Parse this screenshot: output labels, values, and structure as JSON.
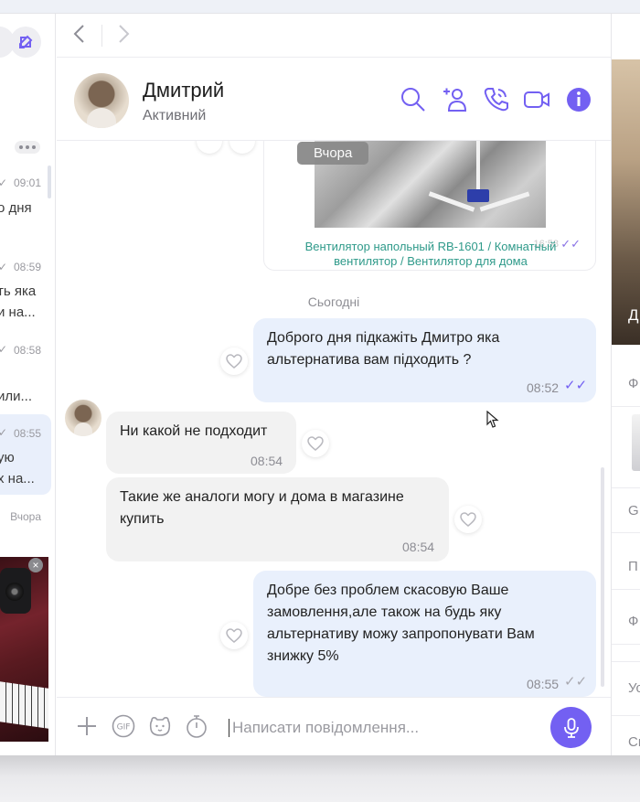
{
  "chat_list": {
    "items": [
      {
        "time": "09:01",
        "preview": "о дня"
      },
      {
        "time": "08:59",
        "preview_line1": "ть яка",
        "preview_line2": "и на..."
      },
      {
        "time": "08:58",
        "preview": "или..."
      },
      {
        "time": "08:55",
        "preview_line1": "ую",
        "preview_line2": "х на..."
      }
    ],
    "footer_time": "Вчора"
  },
  "contact": {
    "name": "Дмитрий",
    "status": "Активний"
  },
  "media_message": {
    "date_badge": "Вчора",
    "caption": "Вентилятор напольный RB-1601 / Комнатный вентилятор / Вентилятор для дома",
    "time": "16:58",
    "ticks": "✓✓"
  },
  "date_separator": "Сьогодні",
  "messages": [
    {
      "direction": "out",
      "text": "Доброго дня підкажіть Дмитро яка альтернатива вам підходить ?",
      "time": "08:52",
      "ticks": "✓✓",
      "ticks_color": "#7360f2"
    },
    {
      "direction": "in",
      "text": "Ни какой не подходит",
      "time": "08:54"
    },
    {
      "direction": "in",
      "text": "Такие же аналоги могу и дома в магазине купить",
      "time": "08:54"
    },
    {
      "direction": "out",
      "text": "Добре без проблем скасовую Ваше замовлення,але також на будь яку альтернативу можу запропонувати Вам знижку 5%",
      "time": "08:55",
      "ticks": "✓✓",
      "ticks_color": "#a9a9b0"
    }
  ],
  "composer": {
    "placeholder": "Написати повідомлення..."
  },
  "right_panel": {
    "photo_label": "Д",
    "rows": [
      "Ф",
      "G",
      "П",
      "Ф",
      "Ус",
      "Сп"
    ]
  },
  "colors": {
    "accent": "#7360f2",
    "outgoing_bubble": "#e9f0fc",
    "incoming_bubble": "#f2f2f2"
  }
}
